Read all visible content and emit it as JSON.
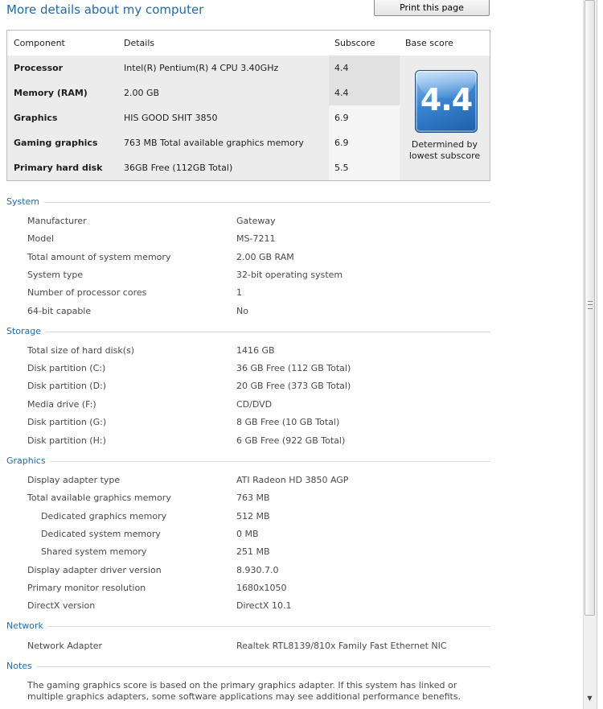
{
  "title": "More details about my computer",
  "print_button": "Print this page",
  "score_table": {
    "headers": {
      "component": "Component",
      "details": "Details",
      "subscore": "Subscore",
      "base_score": "Base score"
    },
    "rows": [
      {
        "component": "Processor",
        "details": "Intel(R) Pentium(R) 4 CPU 3.40GHz",
        "subscore": "4.4"
      },
      {
        "component": "Memory (RAM)",
        "details": "2.00 GB",
        "subscore": "4.4"
      },
      {
        "component": "Graphics",
        "details": "HIS GOOD SHIT 3850",
        "subscore": "6.9"
      },
      {
        "component": "Gaming graphics",
        "details": "763 MB Total available graphics memory",
        "subscore": "6.9"
      },
      {
        "component": "Primary hard disk",
        "details": "36GB Free (112GB Total)",
        "subscore": "5.5"
      }
    ],
    "base_score": "4.4",
    "base_caption": "Determined by lowest subscore"
  },
  "sections": {
    "system": {
      "label": "System",
      "items": [
        {
          "k": "Manufacturer",
          "v": "Gateway"
        },
        {
          "k": "Model",
          "v": "MS-7211"
        },
        {
          "k": "Total amount of system memory",
          "v": "2.00 GB RAM"
        },
        {
          "k": "System type",
          "v": "32-bit operating system"
        },
        {
          "k": "Number of processor cores",
          "v": "1"
        },
        {
          "k": "64-bit capable",
          "v": "No"
        }
      ]
    },
    "storage": {
      "label": "Storage",
      "items": [
        {
          "k": "Total size of hard disk(s)",
          "v": "1416 GB"
        },
        {
          "k": "Disk partition (C:)",
          "v": "36 GB Free (112 GB Total)"
        },
        {
          "k": "Disk partition (D:)",
          "v": "20 GB Free (373 GB Total)"
        },
        {
          "k": "Media drive (F:)",
          "v": "CD/DVD"
        },
        {
          "k": "Disk partition (G:)",
          "v": "8 GB Free (10 GB Total)"
        },
        {
          "k": "Disk partition (H:)",
          "v": "6 GB Free (922 GB Total)"
        }
      ]
    },
    "graphics": {
      "label": "Graphics",
      "items": [
        {
          "k": "Display adapter type",
          "v": "ATI Radeon HD 3850 AGP"
        },
        {
          "k": "Total available graphics memory",
          "v": "763 MB"
        },
        {
          "k": "Dedicated graphics memory",
          "v": "512 MB"
        },
        {
          "k": "Dedicated system memory",
          "v": "0 MB"
        },
        {
          "k": "Shared system memory",
          "v": "251 MB"
        },
        {
          "k": "Display adapter driver version",
          "v": "8.930.7.0"
        },
        {
          "k": "Primary monitor resolution",
          "v": "1680x1050"
        },
        {
          "k": "DirectX version",
          "v": "DirectX 10.1"
        }
      ]
    },
    "network": {
      "label": "Network",
      "items": [
        {
          "k": "Network Adapter",
          "v": "Realtek RTL8139/810x Family Fast Ethernet NIC"
        }
      ]
    },
    "notes": {
      "label": "Notes",
      "text": "The gaming graphics score is based on the primary graphics adapter. If this system has linked or multiple graphics adapters, some software applications may see additional performance benefits."
    }
  },
  "colors": {
    "link_blue": "#1e6bb0",
    "row_gray": "#ececec",
    "row_gray_dark": "#e2e2e2"
  }
}
